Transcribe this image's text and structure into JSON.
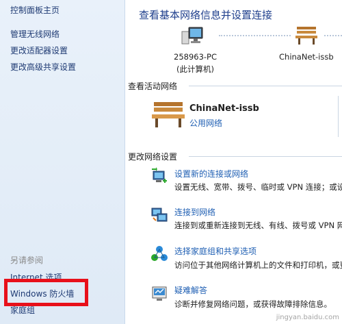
{
  "sidebar": {
    "home": "控制面板主页",
    "items": [
      "管理无线网络",
      "更改适配器设置",
      "更改高级共享设置"
    ],
    "see_also": "另请参阅",
    "see_also_items": [
      "Internet 选项",
      "Windows 防火墙",
      "家庭组"
    ],
    "highlight_color": "#e8101a"
  },
  "main": {
    "title": "查看基本网络信息并设置连接",
    "map": {
      "pc_name": "258963-PC",
      "pc_sub": "(此计算机)",
      "network_name": "ChinaNet-issb"
    },
    "active_section": "查看活动网络",
    "active_network": {
      "name": "ChinaNet-issb",
      "type": "公用网络"
    },
    "change_section": "更改网络设置",
    "tasks": [
      {
        "title": "设置新的连接或网络",
        "desc": "设置无线、宽带、拨号、临时或 VPN 连接；或设",
        "icon": "new-connection-icon"
      },
      {
        "title": "连接到网络",
        "desc": "连接到或重新连接到无线、有线、拨号或 VPN 网",
        "icon": "connect-network-icon"
      },
      {
        "title": "选择家庭组和共享选项",
        "desc": "访问位于其他网络计算机上的文件和打印机，或更",
        "icon": "homegroup-icon"
      },
      {
        "title": "疑难解答",
        "desc": "诊断并修复网络问题，或获得故障排除信息。",
        "icon": "troubleshoot-icon"
      }
    ],
    "link_color": "#1f5fb3",
    "title_color": "#1e3e8c"
  },
  "watermark": "jingyan.baidu.com"
}
